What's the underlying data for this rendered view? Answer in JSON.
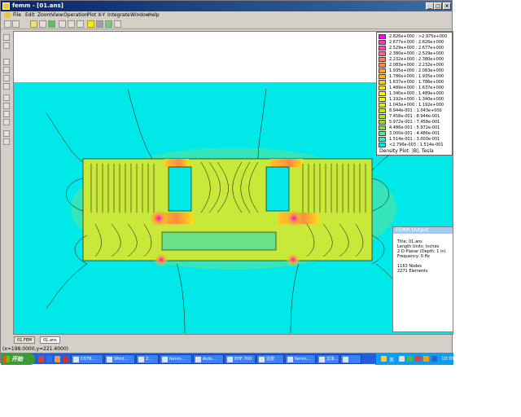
{
  "window": {
    "title": "femm - [01.ans]",
    "controls": [
      "_",
      "□",
      "×"
    ]
  },
  "menu": [
    "File",
    "Edit",
    "Zoom",
    "View",
    "Operation",
    "Plot X-Y",
    "Integrate",
    "Window",
    "Help"
  ],
  "legend": {
    "entries": [
      {
        "label": "2.826e+000 : >2.975e+000",
        "color": "#ff00ff"
      },
      {
        "label": "2.677e+000 : 2.826e+000",
        "color": "#ff33cc"
      },
      {
        "label": "2.529e+000 : 2.677e+000",
        "color": "#ff4da6"
      },
      {
        "label": "2.380e+000 : 2.529e+000",
        "color": "#ff6680"
      },
      {
        "label": "2.232e+000 : 2.380e+000",
        "color": "#ff7a5c"
      },
      {
        "label": "2.083e+000 : 2.232e+000",
        "color": "#ff8c40"
      },
      {
        "label": "1.935e+000 : 2.083e+000",
        "color": "#ffa030"
      },
      {
        "label": "1.786e+000 : 1.935e+000",
        "color": "#ffb428"
      },
      {
        "label": "1.637e+000 : 1.786e+000",
        "color": "#ffc820"
      },
      {
        "label": "1.489e+000 : 1.637e+000",
        "color": "#ffdc18"
      },
      {
        "label": "1.340e+000 : 1.489e+000",
        "color": "#fff010"
      },
      {
        "label": "1.192e+000 : 1.340e+000",
        "color": "#f0f810"
      },
      {
        "label": "1.043e+000 : 1.192e+000",
        "color": "#d8f018"
      },
      {
        "label": "8.944e-001 : 1.043e+000",
        "color": "#c0e820"
      },
      {
        "label": "7.458e-001 : 8.944e-001",
        "color": "#a8e028"
      },
      {
        "label": "5.972e-001 : 7.458e-001",
        "color": "#90d838"
      },
      {
        "label": "4.486e-001 : 5.972e-001",
        "color": "#78d860"
      },
      {
        "label": "3.000e-001 : 4.486e-001",
        "color": "#60e090"
      },
      {
        "label": "1.514e-001 : 3.000e-001",
        "color": "#40e8c0"
      },
      {
        "label": "<2.796e-003 : 1.514e-001",
        "color": "#00e8e8"
      }
    ],
    "caption": "Density Plot: |B|, Tesla"
  },
  "output": {
    "heading": "FEMM Output",
    "lines": [
      "Title: 01.ans",
      "Length Units: Inches",
      "2-D Planar (Depth: 1 in)",
      "Frequency: 0 Hz",
      "",
      "1163 Nodes",
      "2271 Elements"
    ]
  },
  "tabs": [
    "01.FEM",
    "01.ans"
  ],
  "status": "(x=198.0000,y=221.4000)",
  "taskbar": {
    "start": "开始",
    "tasks": [
      "DSTR...",
      "Wind...",
      "Z...",
      "femm...",
      "Auto...",
      "EHF-700",
      "迅雷",
      "femm...",
      "文本...",
      ""
    ],
    "tray_text": "英",
    "clock": "10:00"
  },
  "colors": {
    "field_background": "#00e8e8",
    "core_fill": "#c8e83a"
  }
}
